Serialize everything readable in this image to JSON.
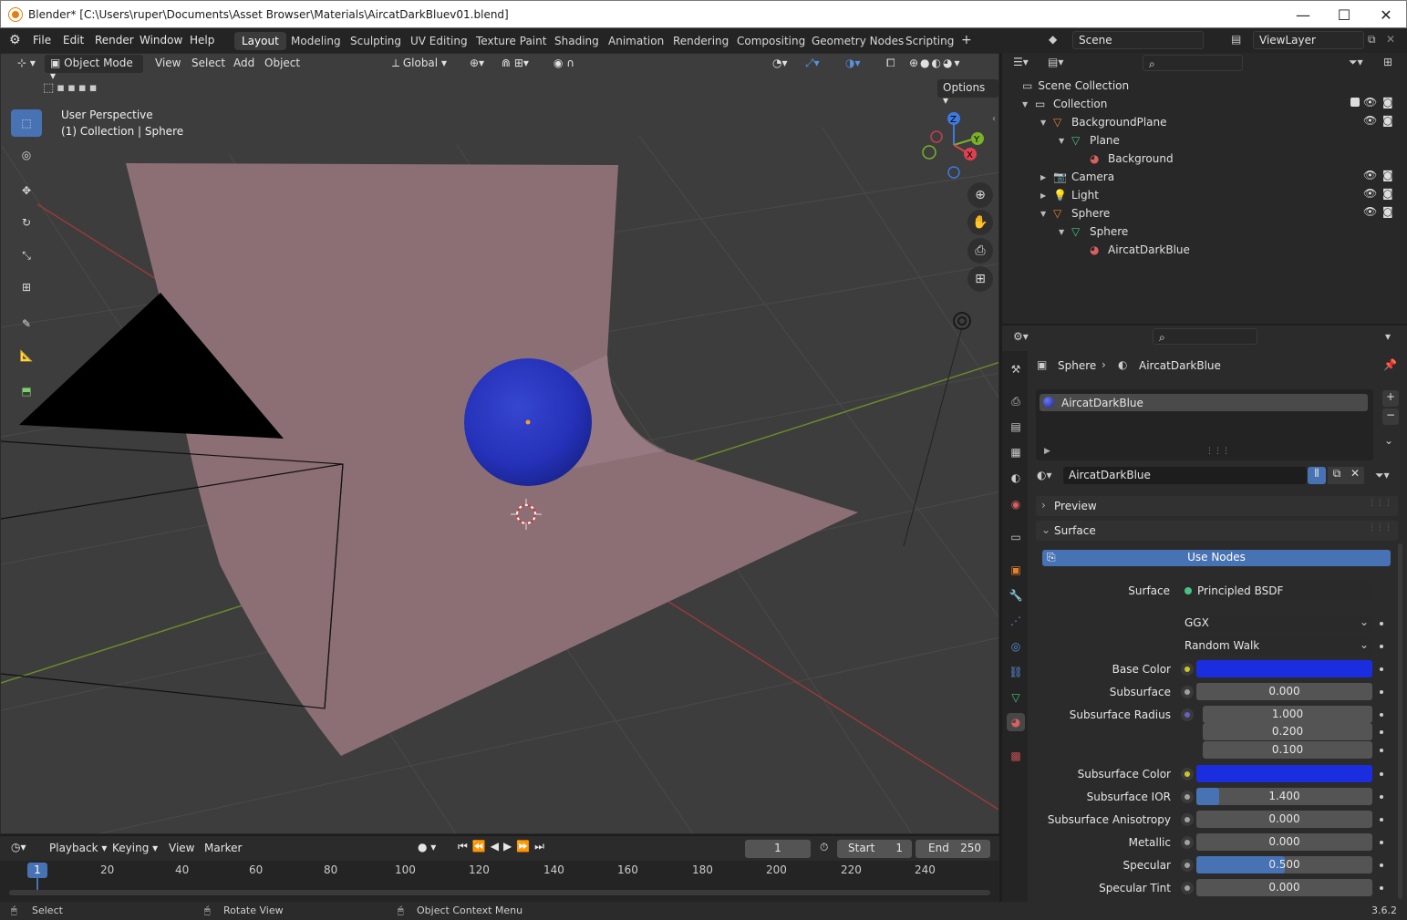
{
  "window": {
    "title": "Blender* [C:\\Users\\ruper\\Documents\\Asset Browser\\Materials\\AircatDarkBluev01.blend]",
    "minimize": "—",
    "maximize": "☐",
    "close": "✕"
  },
  "menubar": {
    "menus": [
      "File",
      "Edit",
      "Render",
      "Window",
      "Help"
    ],
    "workspaces": [
      "Layout",
      "Modeling",
      "Sculpting",
      "UV Editing",
      "Texture Paint",
      "Shading",
      "Animation",
      "Rendering",
      "Compositing",
      "Geometry Nodes",
      "Scripting"
    ],
    "active_workspace": "Layout",
    "add_workspace": "+",
    "scene": "Scene",
    "view_layer": "ViewLayer"
  },
  "viewport": {
    "mode": "Object Mode",
    "menus": [
      "View",
      "Select",
      "Add",
      "Object"
    ],
    "transform_orientation": "Global",
    "options_label": "Options",
    "perspective_text": "User Perspective",
    "collection_text": "(1) Collection | Sphere",
    "gizmo_axes": [
      "Z",
      "Y",
      "X"
    ]
  },
  "outliner": {
    "root": "Scene Collection",
    "rows": [
      {
        "label": "Collection",
        "indent": 0,
        "icon": "collection-icon",
        "expanded": true
      },
      {
        "label": "BackgroundPlane",
        "indent": 1,
        "icon": "mesh-object-icon",
        "expanded": true
      },
      {
        "label": "Plane",
        "indent": 2,
        "icon": "mesh-data-icon",
        "expanded": true
      },
      {
        "label": "Background",
        "indent": 3,
        "icon": "material-icon",
        "expanded": false
      },
      {
        "label": "Camera",
        "indent": 1,
        "icon": "camera-icon",
        "expanded": false
      },
      {
        "label": "Light",
        "indent": 1,
        "icon": "light-icon",
        "expanded": false
      },
      {
        "label": "Sphere",
        "indent": 1,
        "icon": "mesh-object-icon",
        "expanded": true
      },
      {
        "label": "Sphere",
        "indent": 2,
        "icon": "mesh-data-icon",
        "expanded": true
      },
      {
        "label": "AircatDarkBlue",
        "indent": 3,
        "icon": "material-icon",
        "expanded": false
      }
    ]
  },
  "properties": {
    "breadcrumb_object": "Sphere",
    "breadcrumb_material": "AircatDarkBlue",
    "slot_name": "AircatDarkBlue",
    "material_name": "AircatDarkBlue",
    "preview_label": "Preview",
    "surface_panel_label": "Surface",
    "use_nodes_label": "Use Nodes",
    "surface_label": "Surface",
    "surface_shader": "Principled BSDF",
    "distribution": "GGX",
    "subsurface_method": "Random Walk",
    "fields": [
      {
        "label": "Base Color",
        "value": "",
        "type": "color",
        "color": "#1a2ee0",
        "socket": "#c7c729"
      },
      {
        "label": "Subsurface",
        "value": "0.000",
        "type": "number",
        "fill": 0,
        "socket": "#a1a1a1"
      },
      {
        "label": "Subsurface Radius",
        "value": "1.000",
        "type": "number",
        "fill": 0,
        "socket": "#6363c7"
      },
      {
        "label": "",
        "value": "0.200",
        "type": "number",
        "fill": 0,
        "socket": ""
      },
      {
        "label": "",
        "value": "0.100",
        "type": "number",
        "fill": 0,
        "socket": ""
      },
      {
        "label": "Subsurface Color",
        "value": "",
        "type": "color",
        "color": "#1a2ee0",
        "socket": "#c7c729"
      },
      {
        "label": "Subsurface IOR",
        "value": "1.400",
        "type": "number",
        "fill": 0.13,
        "socket": "#a1a1a1"
      },
      {
        "label": "Subsurface Anisotropy",
        "value": "0.000",
        "type": "number",
        "fill": 0,
        "socket": "#a1a1a1"
      },
      {
        "label": "Metallic",
        "value": "0.000",
        "type": "number",
        "fill": 0,
        "socket": "#a1a1a1"
      },
      {
        "label": "Specular",
        "value": "0.500",
        "type": "number",
        "fill": 0.5,
        "socket": "#a1a1a1"
      },
      {
        "label": "Specular Tint",
        "value": "0.000",
        "type": "number",
        "fill": 0,
        "socket": "#a1a1a1"
      }
    ]
  },
  "timeline": {
    "menus": [
      "Playback",
      "Keying",
      "View",
      "Marker"
    ],
    "current_frame": "1",
    "start_label": "Start",
    "start_value": "1",
    "end_label": "End",
    "end_value": "250",
    "ruler": [
      "20",
      "40",
      "60",
      "80",
      "100",
      "120",
      "140",
      "160",
      "180",
      "200",
      "220",
      "240"
    ],
    "playhead": "1"
  },
  "statusbar": {
    "select": "Select",
    "rotate": "Rotate View",
    "context": "Object Context Menu",
    "version": "3.6.2"
  },
  "colors": {
    "accent": "#4772b3",
    "sphere": "#2431b8",
    "plane": "#8c6f75",
    "grid_bg": "#3d3d3d"
  }
}
